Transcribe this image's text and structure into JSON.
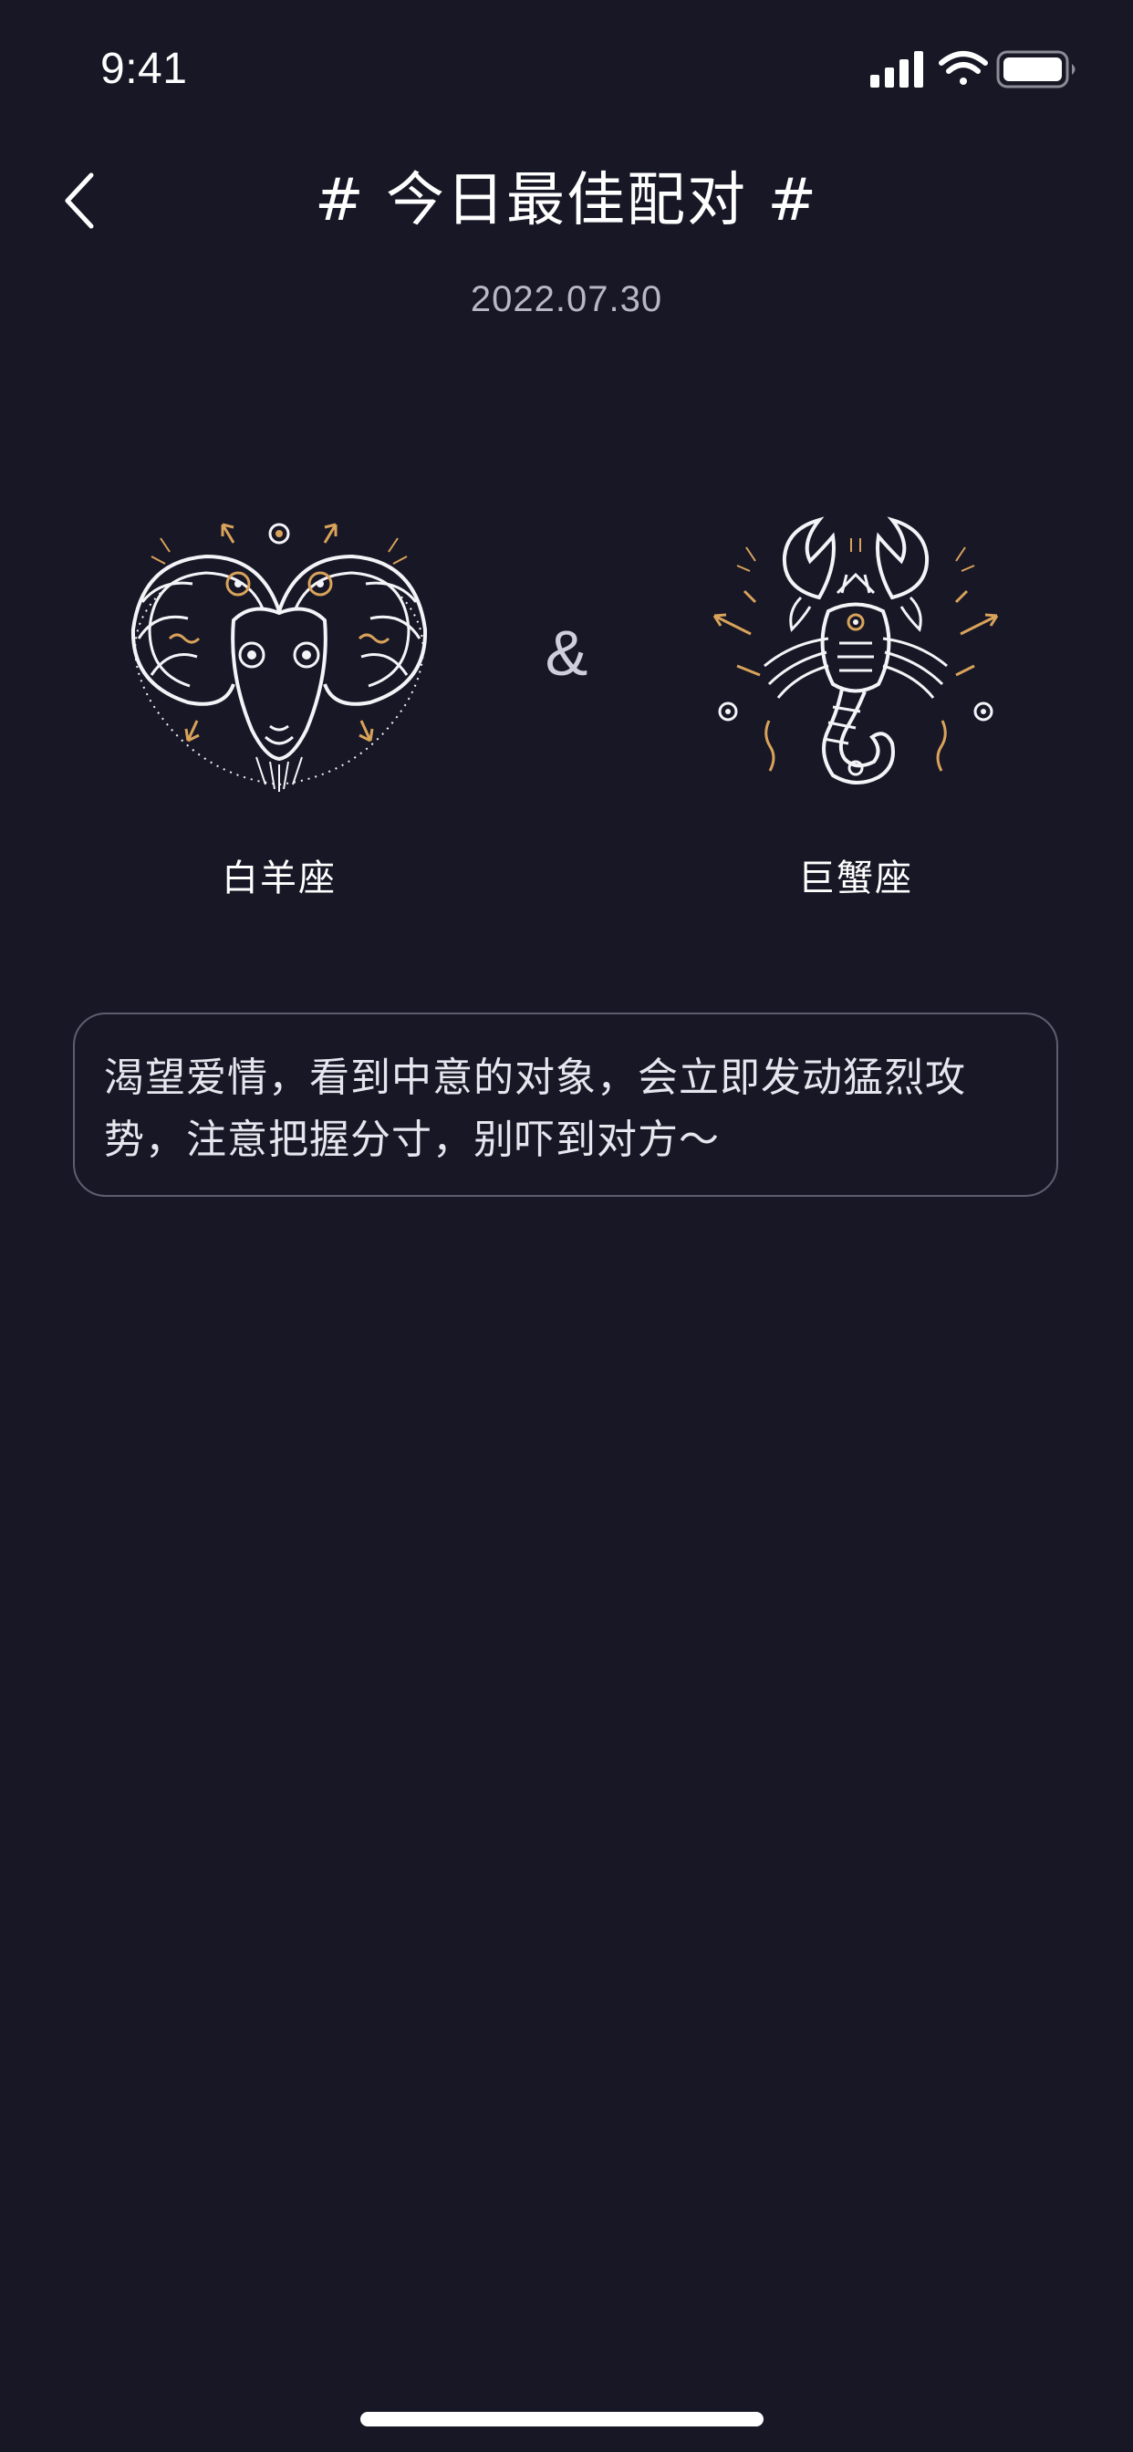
{
  "status_bar": {
    "time": "9:41",
    "icons": [
      "signal-icon",
      "wifi-icon",
      "battery-icon"
    ]
  },
  "nav": {
    "back_icon": "chevron-left-icon",
    "title": "# 今日最佳配对 #"
  },
  "date": "2022.07.30",
  "match": {
    "left_sign": {
      "icon": "aries-icon",
      "label": "白羊座"
    },
    "separator": "&",
    "right_sign": {
      "icon": "cancer-icon",
      "label": "巨蟹座"
    }
  },
  "description": "渴望爱情，看到中意的对象，会立即发动猛烈攻势，注意把握分寸，别吓到对方～",
  "colors": {
    "background": "#181726",
    "accent_gold": "#d9a35a",
    "line_white": "#f4f4f8",
    "card_border": "#5f5e70"
  }
}
